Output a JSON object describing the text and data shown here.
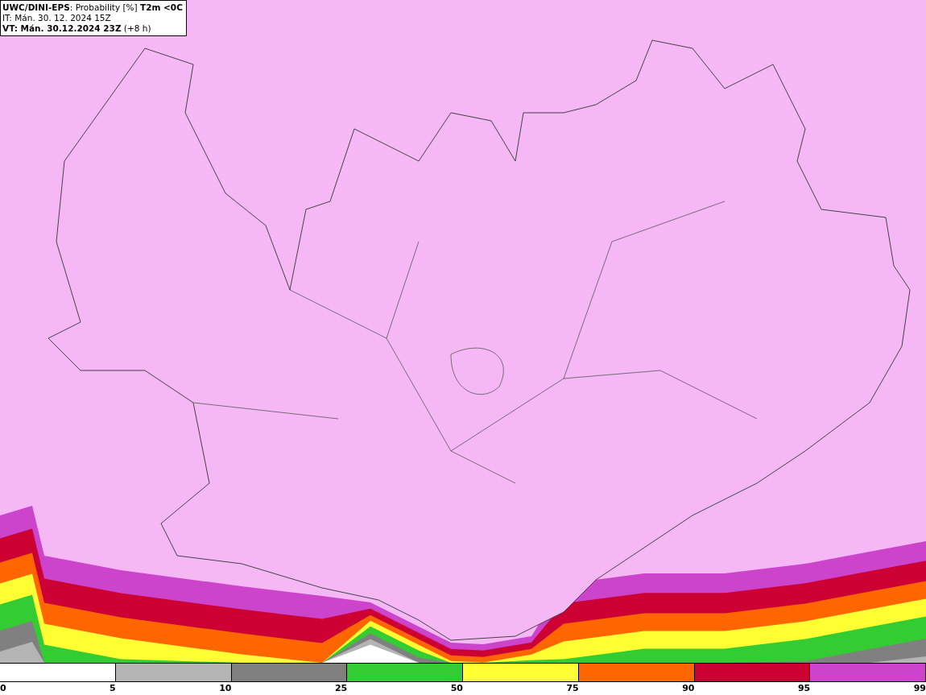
{
  "header": {
    "lines": [
      "**UWC/DINI-EPS**: Probability [%] **T2m <0C**",
      "IT: Mán. 30. 12. 2024 15Z",
      "**VT: Mán. 30.12.2024 23Z** (+8 h)"
    ]
  },
  "colorbar": {
    "segments": [
      {
        "color": "#ffffff"
      },
      {
        "color": "#b4b4b4"
      },
      {
        "color": "#808080"
      },
      {
        "color": "#33cc33"
      },
      {
        "color": "#ffff33"
      },
      {
        "color": "#ff6600"
      },
      {
        "color": "#cc0033"
      },
      {
        "color": "#cc44cc"
      }
    ],
    "ticks": [
      "0",
      "5",
      "10",
      "25",
      "50",
      "75",
      "90",
      "95",
      "99"
    ]
  }
}
